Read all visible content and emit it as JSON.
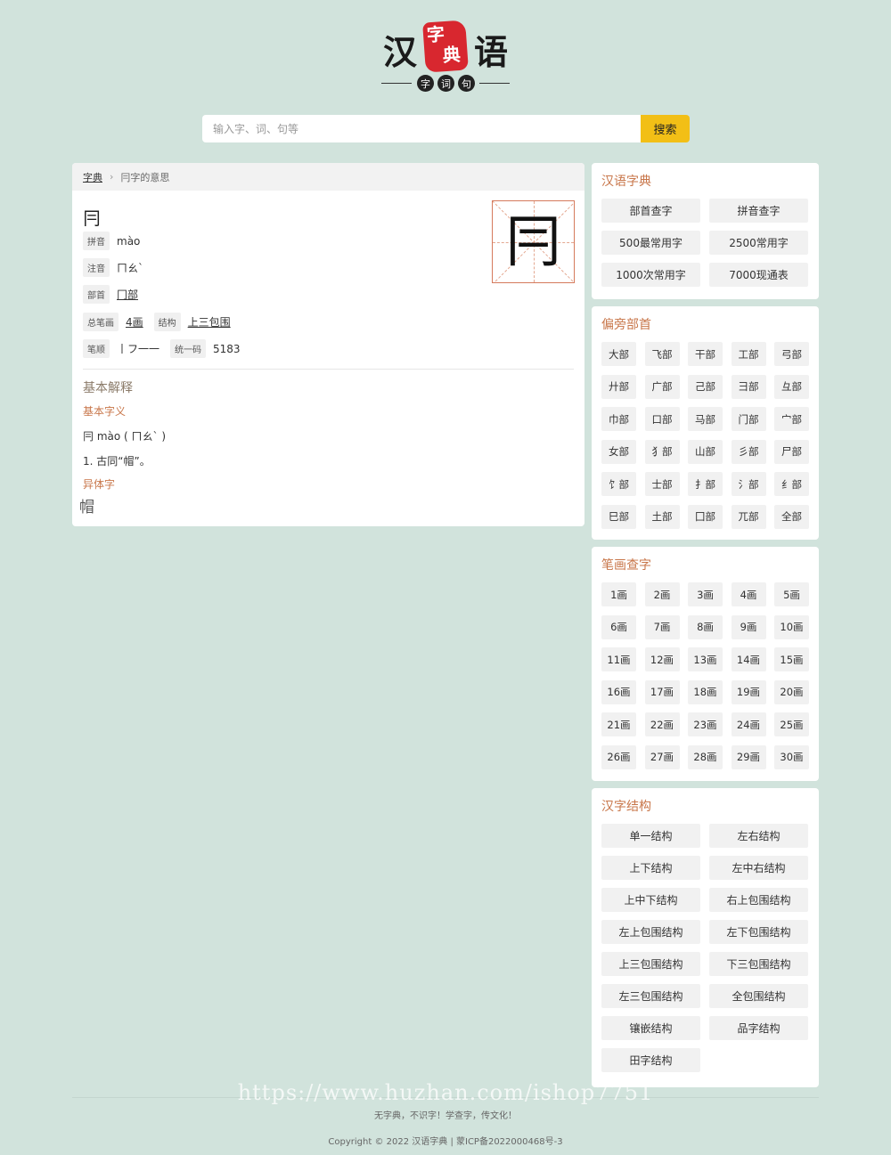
{
  "logo": {
    "left_char": "汉",
    "right_char": "语",
    "seal_top": "字",
    "seal_bottom": "典",
    "circles": [
      "字",
      "词",
      "句"
    ]
  },
  "search": {
    "placeholder": "输入字、词、句等",
    "button": "搜索"
  },
  "breadcrumb": {
    "home": "字典",
    "current": "冃字的意思"
  },
  "char": {
    "glyph": "冃",
    "pinyin_label": "拼音",
    "pinyin": "mào",
    "zhuyin_label": "注音",
    "zhuyin": "ㄇㄠˋ",
    "radical_label": "部首",
    "radical": "冂部",
    "strokes_label": "总笔画",
    "strokes": "4画",
    "structure_label": "结构",
    "structure": "上三包围",
    "order_label": "笔顺",
    "order": "丨フ一一",
    "unicode_label": "统一码",
    "unicode": "5183"
  },
  "basic": {
    "title": "基本解释",
    "subtitle": "基本字义",
    "reading": "冃  mào ( ㄇㄠˋ )",
    "meaning": "1.  古同“帽”。",
    "variant_title": "异体字",
    "variant": "帽"
  },
  "sidebar": {
    "dictionary": {
      "title": "汉语字典",
      "items": [
        "部首查字",
        "拼音查字",
        "500最常用字",
        "2500常用字",
        "1000次常用字",
        "7000现通表"
      ]
    },
    "radicals": {
      "title": "偏旁部首",
      "items": [
        "大部",
        "飞部",
        "干部",
        "工部",
        "弓部",
        "廾部",
        "广部",
        "己部",
        "彐部",
        "彑部",
        "巾部",
        "口部",
        "马部",
        "门部",
        "宀部",
        "女部",
        "犭部",
        "山部",
        "彡部",
        "尸部",
        "饣部",
        "士部",
        "扌部",
        "氵部",
        "纟部",
        "巳部",
        "土部",
        "囗部",
        "兀部",
        "全部"
      ]
    },
    "strokes": {
      "title": "笔画查字",
      "items": [
        "1画",
        "2画",
        "3画",
        "4画",
        "5画",
        "6画",
        "7画",
        "8画",
        "9画",
        "10画",
        "11画",
        "12画",
        "13画",
        "14画",
        "15画",
        "16画",
        "17画",
        "18画",
        "19画",
        "20画",
        "21画",
        "22画",
        "23画",
        "24画",
        "25画",
        "26画",
        "27画",
        "28画",
        "29画",
        "30画"
      ]
    },
    "structures": {
      "title": "汉字结构",
      "items": [
        "单一结构",
        "左右结构",
        "上下结构",
        "左中右结构",
        "上中下结构",
        "右上包围结构",
        "左上包围结构",
        "左下包围结构",
        "上三包围结构",
        "下三包围结构",
        "左三包围结构",
        "全包围结构",
        "镶嵌结构",
        "品字结构",
        "田字结构"
      ]
    }
  },
  "footer": {
    "slogan": "无字典，不识字！学查字，传文化！",
    "copyright": "Copyright © 2022 汉语字典 | 蒙ICP备2022000468号-3",
    "watermark": "https://www.huzhan.com/ishop7751"
  }
}
